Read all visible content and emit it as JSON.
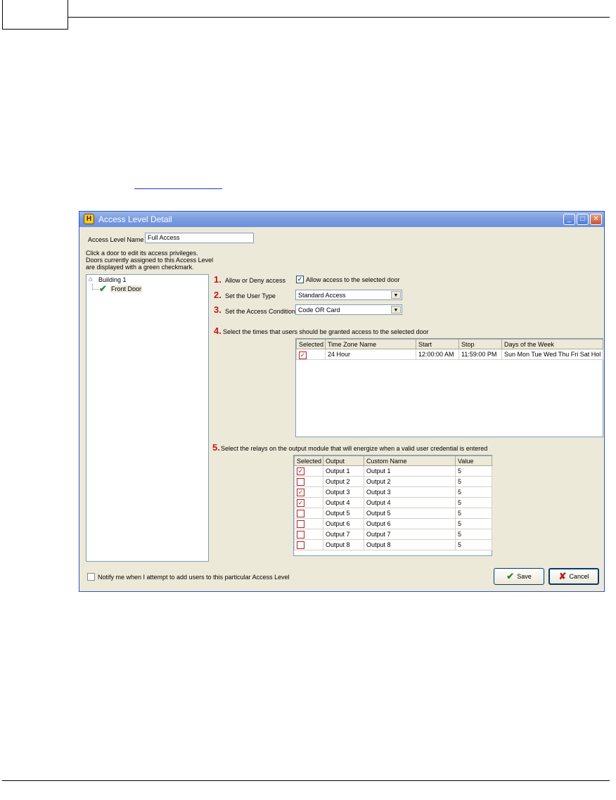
{
  "window": {
    "title": "Access Level Detail",
    "minimize_icon": "minimize-icon",
    "maximize_icon": "maximize-icon",
    "close_icon": "close-icon"
  },
  "access_level_name": {
    "label": "Access Level Name",
    "value": "Full Access"
  },
  "instructions": {
    "line1": "Click a door to edit its access privileges.",
    "line2": "Doors currently assigned to this Access Level",
    "line3": "are displayed with a green checkmark."
  },
  "tree": {
    "root": "Building 1",
    "child": "Front Door"
  },
  "step1": {
    "num": "1.",
    "label": "Allow or Deny access",
    "checkbox_label": "Allow access to the selected door",
    "checked": true
  },
  "step2": {
    "num": "2.",
    "label": "Set the User Type",
    "value": "Standard Access"
  },
  "step3": {
    "num": "3.",
    "label": "Set the Access Condition",
    "value": "Code OR Card"
  },
  "step4": {
    "num": "4.",
    "label": "Select the times that users should be granted access to the selected door",
    "columns": [
      "Selected",
      "Time Zone Name",
      "Start",
      "Stop",
      "Days of the Week"
    ],
    "rows": [
      {
        "selected": true,
        "name": "24 Hour",
        "start": "12:00:00 AM",
        "stop": "11:59:00 PM",
        "days": "Sun Mon Tue Wed Thu Fri Sat Hol"
      }
    ]
  },
  "step5": {
    "num": "5.",
    "label": "Select the relays on the output module that will energize when a valid user credential is entered",
    "columns": [
      "Selected",
      "Output",
      "Custom Name",
      "Value"
    ],
    "rows": [
      {
        "selected": true,
        "output": "Output 1",
        "custom": "Output 1",
        "value": "5"
      },
      {
        "selected": false,
        "output": "Output 2",
        "custom": "Output 2",
        "value": "5"
      },
      {
        "selected": true,
        "output": "Output 3",
        "custom": "Output 3",
        "value": "5"
      },
      {
        "selected": true,
        "output": "Output 4",
        "custom": "Output 4",
        "value": "5"
      },
      {
        "selected": false,
        "output": "Output 5",
        "custom": "Output 5",
        "value": "5"
      },
      {
        "selected": false,
        "output": "Output 6",
        "custom": "Output 6",
        "value": "5"
      },
      {
        "selected": false,
        "output": "Output 7",
        "custom": "Output 7",
        "value": "5"
      },
      {
        "selected": false,
        "output": "Output 8",
        "custom": "Output 8",
        "value": "5"
      }
    ]
  },
  "notify": {
    "label": "Notify me when I attempt to add users to this particular Access Level",
    "checked": false
  },
  "buttons": {
    "save": "Save",
    "cancel": "Cancel"
  },
  "colors": {
    "step_number": "#c4161c",
    "titlebar": "#7b9ee0",
    "window_bg": "#ece9d8",
    "checkmark": "#2e8b2e"
  }
}
